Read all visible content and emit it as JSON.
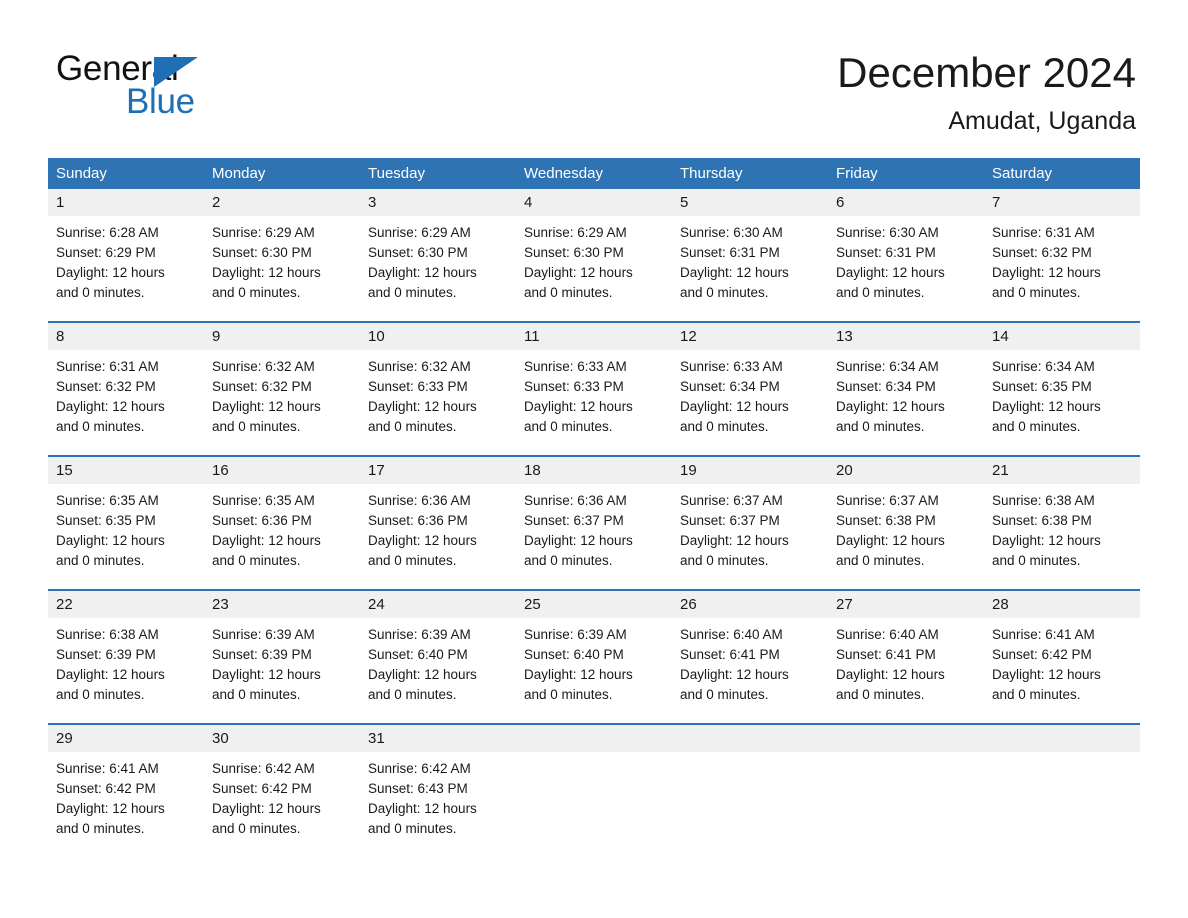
{
  "brand": {
    "name_part1": "General",
    "name_part2": "Blue",
    "logo_icon": "triangle-flag-icon"
  },
  "header": {
    "title": "December 2024",
    "subtitle": "Amudat, Uganda"
  },
  "theme": {
    "header_blue": "#2e74b5",
    "brand_blue": "#1f6fb5",
    "day_number_band": "#f0f0f0",
    "text": "#1a1a1a"
  },
  "calendar": {
    "weekday_headers": [
      "Sunday",
      "Monday",
      "Tuesday",
      "Wednesday",
      "Thursday",
      "Friday",
      "Saturday"
    ],
    "weeks": [
      [
        {
          "day": "1",
          "sunrise": "Sunrise: 6:28 AM",
          "sunset": "Sunset: 6:29 PM",
          "daylight_line1": "Daylight: 12 hours",
          "daylight_line2": "and 0 minutes."
        },
        {
          "day": "2",
          "sunrise": "Sunrise: 6:29 AM",
          "sunset": "Sunset: 6:30 PM",
          "daylight_line1": "Daylight: 12 hours",
          "daylight_line2": "and 0 minutes."
        },
        {
          "day": "3",
          "sunrise": "Sunrise: 6:29 AM",
          "sunset": "Sunset: 6:30 PM",
          "daylight_line1": "Daylight: 12 hours",
          "daylight_line2": "and 0 minutes."
        },
        {
          "day": "4",
          "sunrise": "Sunrise: 6:29 AM",
          "sunset": "Sunset: 6:30 PM",
          "daylight_line1": "Daylight: 12 hours",
          "daylight_line2": "and 0 minutes."
        },
        {
          "day": "5",
          "sunrise": "Sunrise: 6:30 AM",
          "sunset": "Sunset: 6:31 PM",
          "daylight_line1": "Daylight: 12 hours",
          "daylight_line2": "and 0 minutes."
        },
        {
          "day": "6",
          "sunrise": "Sunrise: 6:30 AM",
          "sunset": "Sunset: 6:31 PM",
          "daylight_line1": "Daylight: 12 hours",
          "daylight_line2": "and 0 minutes."
        },
        {
          "day": "7",
          "sunrise": "Sunrise: 6:31 AM",
          "sunset": "Sunset: 6:32 PM",
          "daylight_line1": "Daylight: 12 hours",
          "daylight_line2": "and 0 minutes."
        }
      ],
      [
        {
          "day": "8",
          "sunrise": "Sunrise: 6:31 AM",
          "sunset": "Sunset: 6:32 PM",
          "daylight_line1": "Daylight: 12 hours",
          "daylight_line2": "and 0 minutes."
        },
        {
          "day": "9",
          "sunrise": "Sunrise: 6:32 AM",
          "sunset": "Sunset: 6:32 PM",
          "daylight_line1": "Daylight: 12 hours",
          "daylight_line2": "and 0 minutes."
        },
        {
          "day": "10",
          "sunrise": "Sunrise: 6:32 AM",
          "sunset": "Sunset: 6:33 PM",
          "daylight_line1": "Daylight: 12 hours",
          "daylight_line2": "and 0 minutes."
        },
        {
          "day": "11",
          "sunrise": "Sunrise: 6:33 AM",
          "sunset": "Sunset: 6:33 PM",
          "daylight_line1": "Daylight: 12 hours",
          "daylight_line2": "and 0 minutes."
        },
        {
          "day": "12",
          "sunrise": "Sunrise: 6:33 AM",
          "sunset": "Sunset: 6:34 PM",
          "daylight_line1": "Daylight: 12 hours",
          "daylight_line2": "and 0 minutes."
        },
        {
          "day": "13",
          "sunrise": "Sunrise: 6:34 AM",
          "sunset": "Sunset: 6:34 PM",
          "daylight_line1": "Daylight: 12 hours",
          "daylight_line2": "and 0 minutes."
        },
        {
          "day": "14",
          "sunrise": "Sunrise: 6:34 AM",
          "sunset": "Sunset: 6:35 PM",
          "daylight_line1": "Daylight: 12 hours",
          "daylight_line2": "and 0 minutes."
        }
      ],
      [
        {
          "day": "15",
          "sunrise": "Sunrise: 6:35 AM",
          "sunset": "Sunset: 6:35 PM",
          "daylight_line1": "Daylight: 12 hours",
          "daylight_line2": "and 0 minutes."
        },
        {
          "day": "16",
          "sunrise": "Sunrise: 6:35 AM",
          "sunset": "Sunset: 6:36 PM",
          "daylight_line1": "Daylight: 12 hours",
          "daylight_line2": "and 0 minutes."
        },
        {
          "day": "17",
          "sunrise": "Sunrise: 6:36 AM",
          "sunset": "Sunset: 6:36 PM",
          "daylight_line1": "Daylight: 12 hours",
          "daylight_line2": "and 0 minutes."
        },
        {
          "day": "18",
          "sunrise": "Sunrise: 6:36 AM",
          "sunset": "Sunset: 6:37 PM",
          "daylight_line1": "Daylight: 12 hours",
          "daylight_line2": "and 0 minutes."
        },
        {
          "day": "19",
          "sunrise": "Sunrise: 6:37 AM",
          "sunset": "Sunset: 6:37 PM",
          "daylight_line1": "Daylight: 12 hours",
          "daylight_line2": "and 0 minutes."
        },
        {
          "day": "20",
          "sunrise": "Sunrise: 6:37 AM",
          "sunset": "Sunset: 6:38 PM",
          "daylight_line1": "Daylight: 12 hours",
          "daylight_line2": "and 0 minutes."
        },
        {
          "day": "21",
          "sunrise": "Sunrise: 6:38 AM",
          "sunset": "Sunset: 6:38 PM",
          "daylight_line1": "Daylight: 12 hours",
          "daylight_line2": "and 0 minutes."
        }
      ],
      [
        {
          "day": "22",
          "sunrise": "Sunrise: 6:38 AM",
          "sunset": "Sunset: 6:39 PM",
          "daylight_line1": "Daylight: 12 hours",
          "daylight_line2": "and 0 minutes."
        },
        {
          "day": "23",
          "sunrise": "Sunrise: 6:39 AM",
          "sunset": "Sunset: 6:39 PM",
          "daylight_line1": "Daylight: 12 hours",
          "daylight_line2": "and 0 minutes."
        },
        {
          "day": "24",
          "sunrise": "Sunrise: 6:39 AM",
          "sunset": "Sunset: 6:40 PM",
          "daylight_line1": "Daylight: 12 hours",
          "daylight_line2": "and 0 minutes."
        },
        {
          "day": "25",
          "sunrise": "Sunrise: 6:39 AM",
          "sunset": "Sunset: 6:40 PM",
          "daylight_line1": "Daylight: 12 hours",
          "daylight_line2": "and 0 minutes."
        },
        {
          "day": "26",
          "sunrise": "Sunrise: 6:40 AM",
          "sunset": "Sunset: 6:41 PM",
          "daylight_line1": "Daylight: 12 hours",
          "daylight_line2": "and 0 minutes."
        },
        {
          "day": "27",
          "sunrise": "Sunrise: 6:40 AM",
          "sunset": "Sunset: 6:41 PM",
          "daylight_line1": "Daylight: 12 hours",
          "daylight_line2": "and 0 minutes."
        },
        {
          "day": "28",
          "sunrise": "Sunrise: 6:41 AM",
          "sunset": "Sunset: 6:42 PM",
          "daylight_line1": "Daylight: 12 hours",
          "daylight_line2": "and 0 minutes."
        }
      ],
      [
        {
          "day": "29",
          "sunrise": "Sunrise: 6:41 AM",
          "sunset": "Sunset: 6:42 PM",
          "daylight_line1": "Daylight: 12 hours",
          "daylight_line2": "and 0 minutes."
        },
        {
          "day": "30",
          "sunrise": "Sunrise: 6:42 AM",
          "sunset": "Sunset: 6:42 PM",
          "daylight_line1": "Daylight: 12 hours",
          "daylight_line2": "and 0 minutes."
        },
        {
          "day": "31",
          "sunrise": "Sunrise: 6:42 AM",
          "sunset": "Sunset: 6:43 PM",
          "daylight_line1": "Daylight: 12 hours",
          "daylight_line2": "and 0 minutes."
        },
        {
          "day": "",
          "sunrise": "",
          "sunset": "",
          "daylight_line1": "",
          "daylight_line2": ""
        },
        {
          "day": "",
          "sunrise": "",
          "sunset": "",
          "daylight_line1": "",
          "daylight_line2": ""
        },
        {
          "day": "",
          "sunrise": "",
          "sunset": "",
          "daylight_line1": "",
          "daylight_line2": ""
        },
        {
          "day": "",
          "sunrise": "",
          "sunset": "",
          "daylight_line1": "",
          "daylight_line2": ""
        }
      ]
    ]
  }
}
